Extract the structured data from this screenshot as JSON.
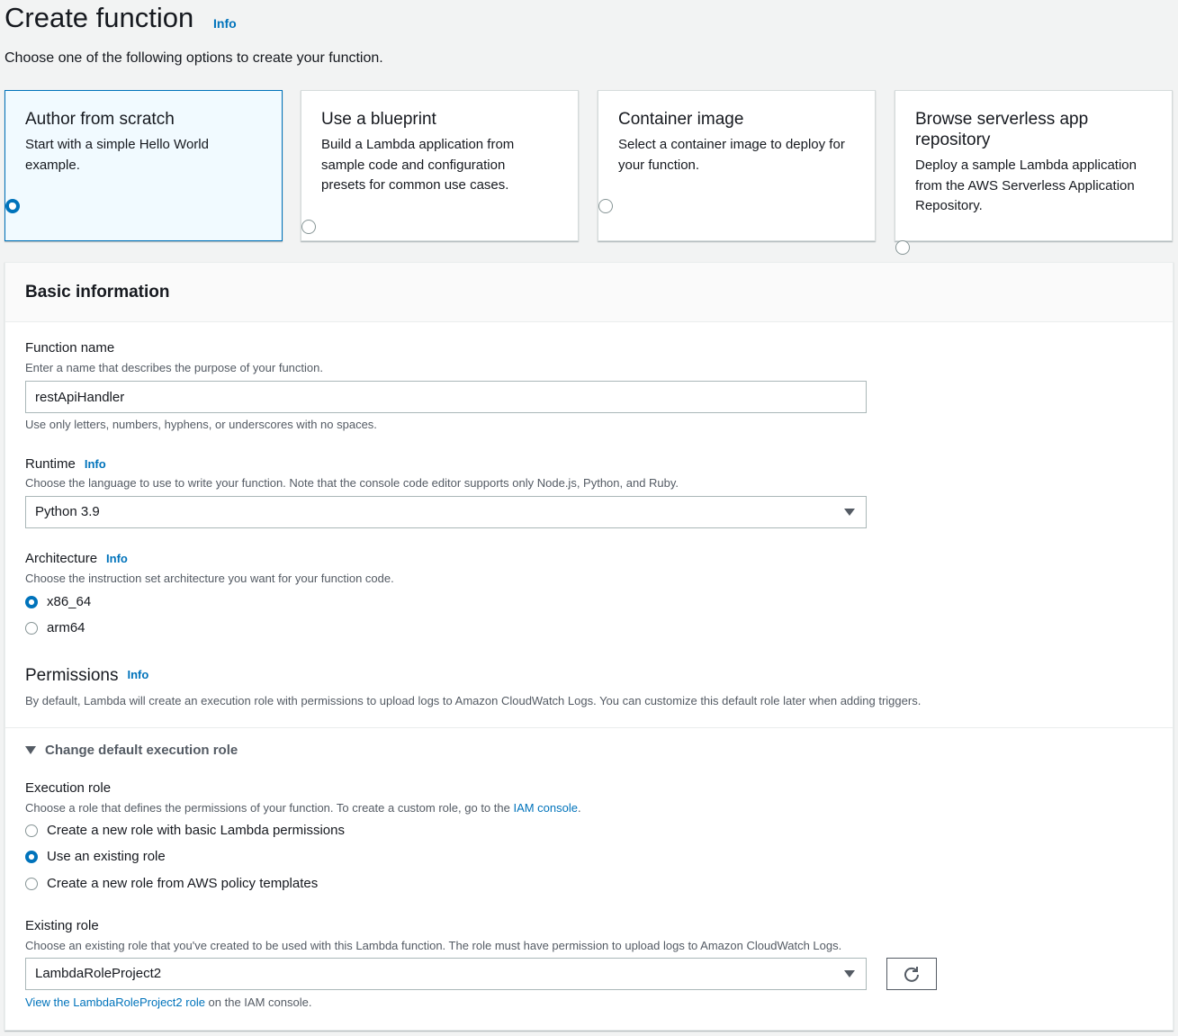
{
  "header": {
    "title": "Create function",
    "info": "Info",
    "description": "Choose one of the following options to create your function."
  },
  "options": [
    {
      "title": "Author from scratch",
      "description": "Start with a simple Hello World example.",
      "selected": true
    },
    {
      "title": "Use a blueprint",
      "description": "Build a Lambda application from sample code and configuration presets for common use cases.",
      "selected": false
    },
    {
      "title": "Container image",
      "description": "Select a container image to deploy for your function.",
      "selected": false
    },
    {
      "title": "Browse serverless app repository",
      "description": "Deploy a sample Lambda application from the AWS Serverless Application Repository.",
      "selected": false
    }
  ],
  "basic": {
    "title": "Basic information",
    "function_name": {
      "label": "Function name",
      "description": "Enter a name that describes the purpose of your function.",
      "value": "restApiHandler",
      "constraint": "Use only letters, numbers, hyphens, or underscores with no spaces."
    },
    "runtime": {
      "label": "Runtime",
      "info": "Info",
      "description": "Choose the language to use to write your function. Note that the console code editor supports only Node.js, Python, and Ruby.",
      "value": "Python 3.9"
    },
    "architecture": {
      "label": "Architecture",
      "info": "Info",
      "description": "Choose the instruction set architecture you want for your function code.",
      "options": [
        {
          "label": "x86_64",
          "selected": true
        },
        {
          "label": "arm64",
          "selected": false
        }
      ]
    },
    "permissions": {
      "title": "Permissions",
      "info": "Info",
      "description": "By default, Lambda will create an execution role with permissions to upload logs to Amazon CloudWatch Logs. You can customize this default role later when adding triggers."
    },
    "execution_role_section": {
      "expander_label": "Change default execution role",
      "label": "Execution role",
      "description_prefix": "Choose a role that defines the permissions of your function. To create a custom role, go to the ",
      "description_link": "IAM console",
      "description_suffix": ".",
      "options": [
        {
          "label": "Create a new role with basic Lambda permissions",
          "selected": false
        },
        {
          "label": "Use an existing role",
          "selected": true
        },
        {
          "label": "Create a new role from AWS policy templates",
          "selected": false
        }
      ]
    },
    "existing_role": {
      "label": "Existing role",
      "description": "Choose an existing role that you've created to be used with this Lambda function. The role must have permission to upload logs to Amazon CloudWatch Logs.",
      "value": "LambdaRoleProject2",
      "view_link": "View the LambdaRoleProject2 role",
      "view_suffix": " on the IAM console."
    }
  },
  "colors": {
    "accent": "#0073bb",
    "selected_tile_bg": "#f1faff",
    "page_bg": "#f2f3f3"
  },
  "icons": {
    "refresh": "refresh-icon",
    "dropdown": "caret-down-icon",
    "expander": "triangle-down-icon"
  }
}
